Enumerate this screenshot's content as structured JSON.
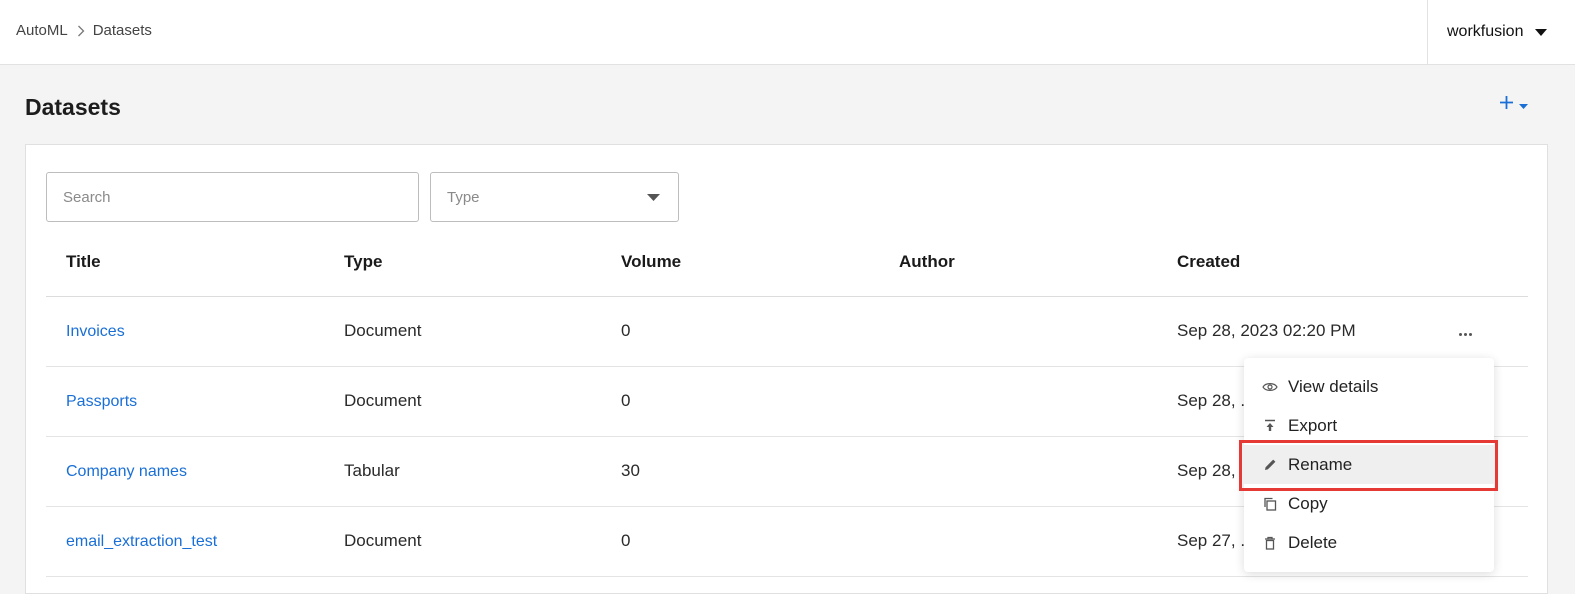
{
  "breadcrumb": {
    "root": "AutoML",
    "current": "Datasets"
  },
  "user": {
    "name": "workfusion"
  },
  "page": {
    "title": "Datasets",
    "add_label": "+"
  },
  "filters": {
    "search_placeholder": "Search",
    "type_placeholder": "Type"
  },
  "table": {
    "columns": [
      "Title",
      "Type",
      "Volume",
      "Author",
      "Created"
    ],
    "rows": [
      {
        "title": "Invoices",
        "type": "Document",
        "volume": "0",
        "author": "",
        "created": "Sep 28, 2023 02:20 PM"
      },
      {
        "title": "Passports",
        "type": "Document",
        "volume": "0",
        "author": "",
        "created": "Sep 28, ."
      },
      {
        "title": "Company names",
        "type": "Tabular",
        "volume": "30",
        "author": "",
        "created": "Sep 28,"
      },
      {
        "title": "email_extraction_test",
        "type": "Document",
        "volume": "0",
        "author": "",
        "created": "Sep 27, ."
      }
    ]
  },
  "context_menu": {
    "items": [
      {
        "label": "View details",
        "icon": "eye-icon"
      },
      {
        "label": "Export",
        "icon": "export-icon"
      },
      {
        "label": "Rename",
        "icon": "pencil-icon"
      },
      {
        "label": "Copy",
        "icon": "copy-icon"
      },
      {
        "label": "Delete",
        "icon": "trash-icon"
      }
    ],
    "active_item": "Rename"
  },
  "colors": {
    "link": "#1a6fd6",
    "highlight": "#e53935",
    "background": "#f4f4f4"
  }
}
